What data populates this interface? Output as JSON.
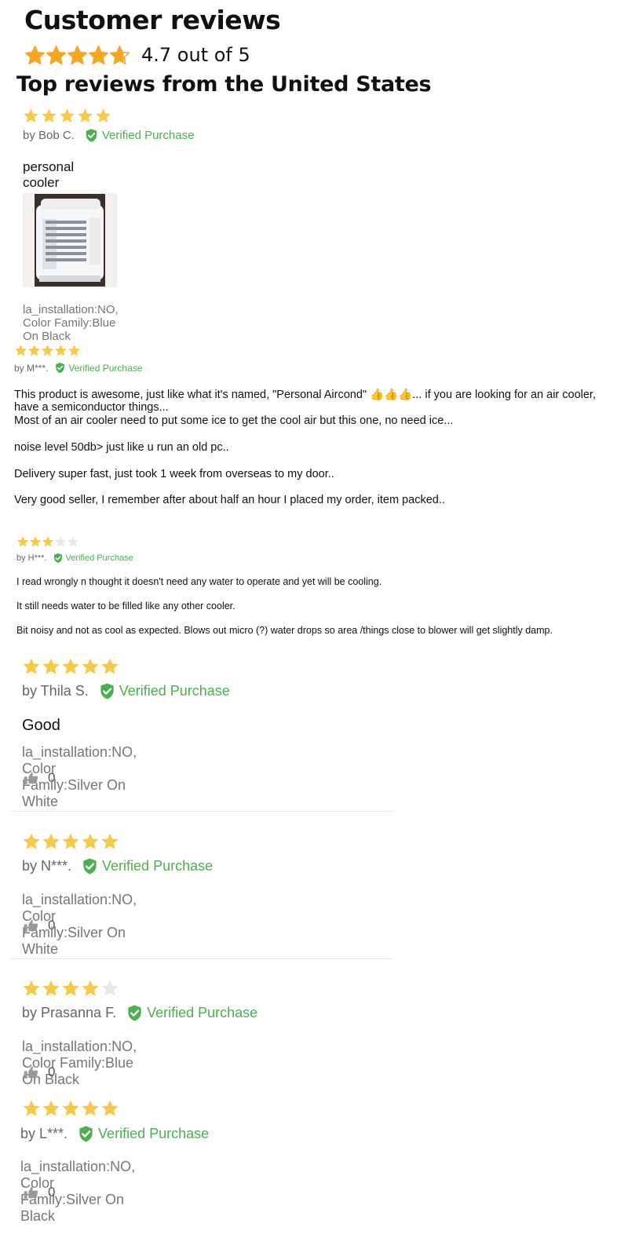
{
  "page": {
    "title": "Customer reviews",
    "average_rating_text": "4.7 out of 5",
    "average_rating": 4.7,
    "section_title": "Top reviews from the United States"
  },
  "colors": {
    "star_summary": "#f5a623",
    "star_review": "#f7c948",
    "star_empty": "#e8e8ec",
    "verified_green": "#4caf50",
    "meta_gray": "#777777"
  },
  "reviews": [
    {
      "rating": 5,
      "author": "by Bob C.",
      "verified": "Verified Purchase",
      "title": "personal cooler",
      "has_photo": true,
      "photo_icon": "air-cooler-photo",
      "variant": "la_installation:NO, Color Family:Blue On Black"
    },
    {
      "rating": 5,
      "author": "by M***.",
      "verified": "Verified Purchase",
      "body": [
        "This product is awesome, just like what it's named, \"Personal Aircond\" 👍👍👍... if you are looking for an air cooler,",
        "have a semiconductor things...",
        "Most of an air cooler need to put some ice to get the cool air but this one, no need ice...",
        "noise level 50db> just like u run an old pc..",
        "Delivery super fast, just took 1 week from overseas to my door..",
        "Very good seller, I remember after about half an hour I placed my order, item packed.."
      ]
    },
    {
      "rating": 3,
      "author": "by H***.",
      "verified": "Verified Purchase",
      "body": [
        "I read wrongly n thought it doesn't need any water to operate and yet will be cooling.",
        "It still needs water to be filled like any other cooler.",
        "Bit noisy and not as cool as expected. Blows out micro (?) water drops so area /things close to blower will get slightly damp."
      ]
    },
    {
      "rating": 5,
      "author": "by Thila S.",
      "verified": "Verified Purchase",
      "title": "Good",
      "variant": "la_installation:NO, Color Family:Silver On White",
      "helpful_count": "0"
    },
    {
      "rating": 5,
      "author": "by N***.",
      "verified": "Verified Purchase",
      "variant": "la_installation:NO, Color Family:Silver On White",
      "helpful_count": "0"
    },
    {
      "rating": 4,
      "author": "by Prasanna F.",
      "verified": "Verified Purchase",
      "variant": "la_installation:NO, Color Family:Blue On Black",
      "helpful_count": "0"
    },
    {
      "rating": 5,
      "author": "by L***.",
      "verified": "Verified Purchase",
      "variant": "la_installation:NO, Color Family:Silver On Black",
      "helpful_count": "0"
    }
  ]
}
